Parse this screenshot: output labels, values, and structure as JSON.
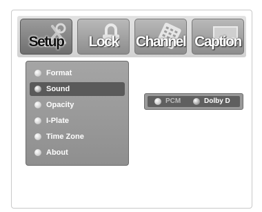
{
  "tabs": [
    {
      "label": "Setup",
      "icon": "wrench-icon",
      "state": "active"
    },
    {
      "label": "Lock",
      "icon": "padlock-icon",
      "state": "inactive"
    },
    {
      "label": "Channel",
      "icon": "remote-keypad-icon",
      "state": "inactive"
    },
    {
      "label": "Caption",
      "icon": "caption-screen-icon",
      "state": "inactive"
    }
  ],
  "menu": {
    "items": [
      {
        "label": "Format"
      },
      {
        "label": "Sound"
      },
      {
        "label": "Opacity"
      },
      {
        "label": "I-Plate"
      },
      {
        "label": "Time Zone"
      },
      {
        "label": "About"
      }
    ],
    "selected_index": 1
  },
  "sound_options": {
    "items": [
      {
        "label": "PCM",
        "state": "unselected"
      },
      {
        "label": "Dolby D",
        "state": "selected"
      }
    ]
  }
}
